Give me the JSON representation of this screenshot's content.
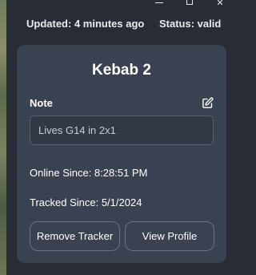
{
  "window": {
    "minimize_icon": "minimize-icon",
    "maximize_icon": "maximize-icon",
    "close_icon": "close-icon",
    "close_glyph": "✕"
  },
  "status_bar": {
    "updated": "Updated: 4 minutes ago",
    "status": "Status: valid"
  },
  "tracker_card": {
    "title": "Kebab 2",
    "note_label": "Note",
    "edit_icon": "edit-pencil-icon",
    "note_value": "Lives G14 in 2x1",
    "online_since": "Online Since: 8:28:51 PM",
    "tracked_since": "Tracked Since: 5/1/2024",
    "remove_button": "Remove Tracker",
    "view_profile_button": "View Profile"
  },
  "colors": {
    "background": "#272c35",
    "card": "#3a4150",
    "field": "#323946",
    "border": "#57606f",
    "text": "#ffffff"
  }
}
